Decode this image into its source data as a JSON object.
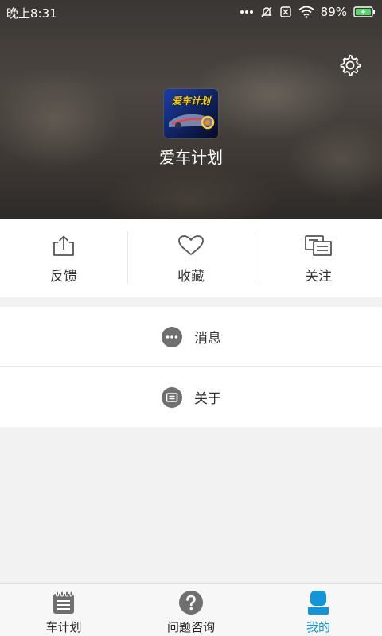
{
  "status_bar": {
    "time": "晚上8:31",
    "battery": "89%"
  },
  "header": {
    "app_name": "爱车计划",
    "logo_text": "爱车计划"
  },
  "actions": [
    {
      "label": "反馈",
      "icon": "share-upload-icon"
    },
    {
      "label": "收藏",
      "icon": "heart-icon"
    },
    {
      "label": "关注",
      "icon": "follow-cards-icon"
    }
  ],
  "menu": [
    {
      "label": "消息",
      "icon": "message-dots-icon"
    },
    {
      "label": "关于",
      "icon": "about-info-icon"
    }
  ],
  "bottom_nav": [
    {
      "label": "车计划",
      "icon": "notepad-icon",
      "active": false
    },
    {
      "label": "问题咨询",
      "icon": "question-circle-icon",
      "active": false
    },
    {
      "label": "我的",
      "icon": "user-profile-icon",
      "active": true
    }
  ],
  "colors": {
    "accent": "#1296db",
    "icon_gray": "#666666",
    "text": "#333333"
  }
}
